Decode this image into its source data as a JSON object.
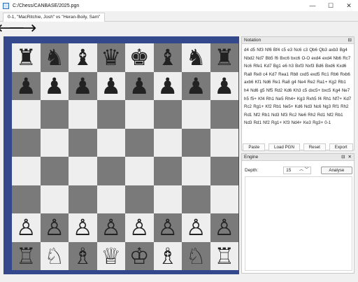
{
  "window": {
    "title": "C:/Chess/CANBASE/2025.pgn",
    "controls": [
      "—",
      "☐",
      "✕"
    ]
  },
  "tab": {
    "label": "0-1, \"MacRitchie, Josh\" vs \"Heran-Boily, Sam\""
  },
  "nav": {
    "back": "🡐",
    "forward": "🡒"
  },
  "board": {
    "ranks": [
      [
        "♜",
        "♞",
        "♝",
        "♛",
        "♚",
        "♝",
        "♞",
        "♜"
      ],
      [
        "♟",
        "♟",
        "♟",
        "♟",
        "♟",
        "♟",
        "♟",
        "♟"
      ],
      [
        "",
        "",
        "",
        "",
        "",
        "",
        "",
        ""
      ],
      [
        "",
        "",
        "",
        "",
        "",
        "",
        "",
        ""
      ],
      [
        "",
        "",
        "",
        "",
        "",
        "",
        "",
        ""
      ],
      [
        "",
        "",
        "",
        "",
        "",
        "",
        "",
        ""
      ],
      [
        "♙",
        "♙",
        "♙",
        "♙",
        "♙",
        "♙",
        "♙",
        "♙"
      ],
      [
        "♖",
        "♘",
        "♗",
        "♕",
        "♔",
        "♗",
        "♘",
        "♖"
      ]
    ]
  },
  "notation": {
    "title": "Notation",
    "header_icons": [
      "⊟"
    ],
    "moves": "d4 d5 Nf3 Nf6 Bf4 c5 e3 Nc6 c3 Qb6 Qb3 axb3 Bg4 Nbd2 Nd7 Bb5 f6 Bxc6 bxc6 O-O exd4 exd4 Nb6 Rc7 Nc6 Rfe1 Kd7 Bg1 e6 h3 Bxf3 Nxf3 Bd6 Bxd6 Kxd6 Ra8 Re8 c4 Kd7 Rea1 Rb8 cxd5 exd5 Rc1 Rb6 Rxb6 axb6 Kf1 Nd6 Re1 Ra8 g4 Ne4 Re2 Ra1+ Kg2 Rb1 h4 Nd6 g5 Nf5 Rd2 Kd6 Kh3 c5 dxc5+ bxc5 Kg4 Ne7 h5 f5+ Kf4 Rh1 Ne5 Rh4+ Kg3 Rxh5 f4 Rh1 Nf7+ Kd7 Rc2 Rg1+ Kf2 Rb1 Ne5+ Kd6 Nd3 Nc6 Ng3 Rf1 Rh2 Rd1 Nf2 Rb1 Nd3 Nf3 Rc2 Ne6 Rh2 Rd1 Nf2 Rb1 Nd3 Rd1 Nf2 Rg1+ Kf3 Nd4+ Ke3 Rg3+ 0-1"
  },
  "notation_buttons": [
    "Paste",
    "Load PGN",
    "Reset",
    "Export"
  ],
  "engine": {
    "title": "Engine",
    "header_icons": [
      "⊟",
      "✕"
    ],
    "depth_label": "Depth:",
    "depth_value": "15",
    "stepper": "︿ ﹀",
    "analyse_label": "Analyse"
  },
  "colors": {
    "board_frame": "#34498b",
    "light_square": "#eeeeee",
    "dark_square": "#7a7a7a"
  }
}
